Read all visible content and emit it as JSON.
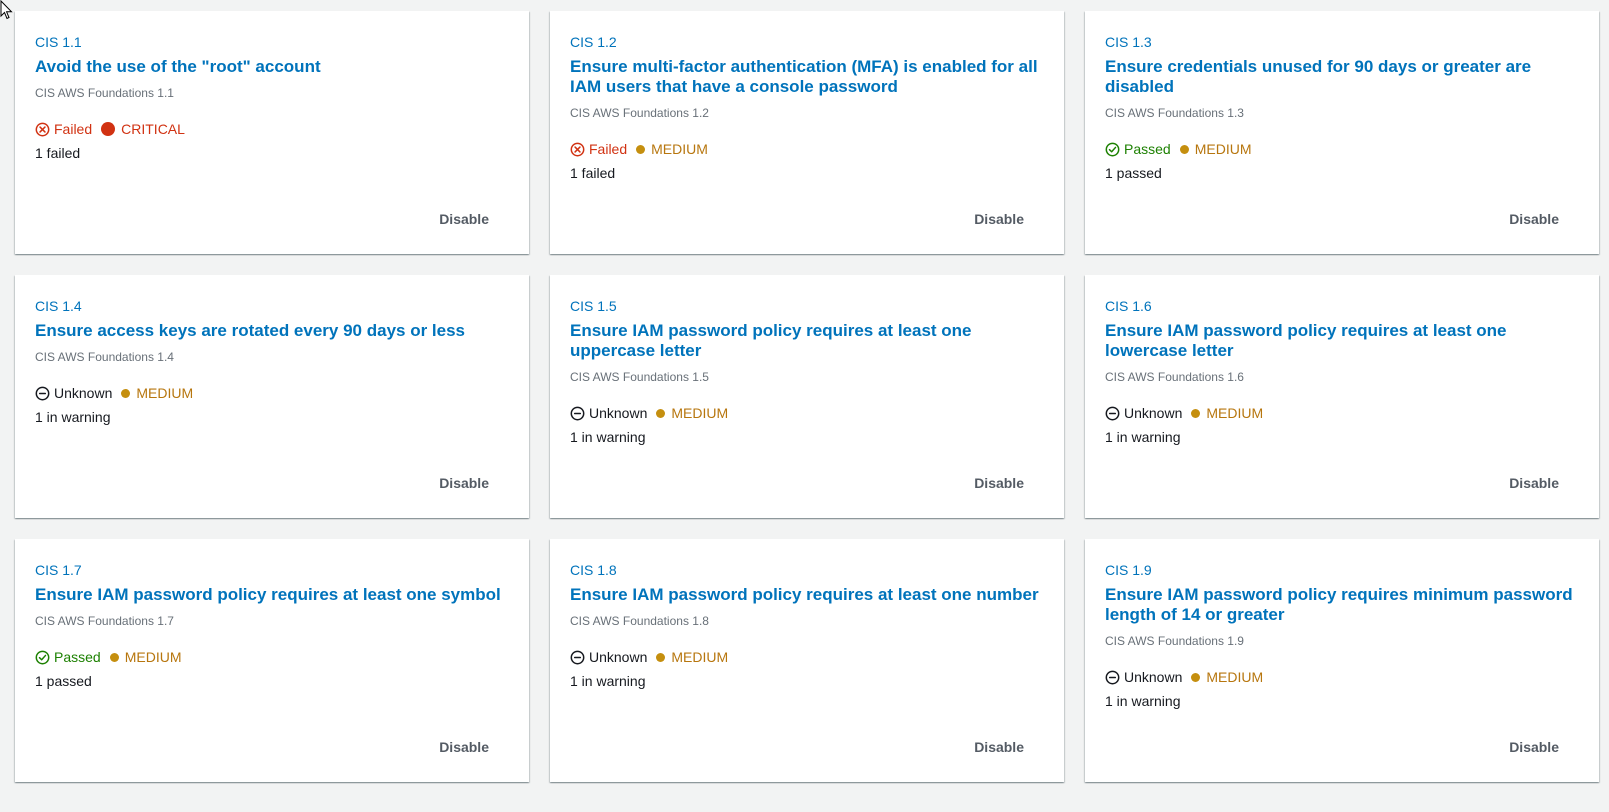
{
  "colors": {
    "link": "#0073bb",
    "failed": "#d13212",
    "passed": "#1d8102",
    "critical": "#d13212",
    "medium": "#c58f0f",
    "medium_text": "#b7760e"
  },
  "cards": [
    {
      "id": "CIS 1.1",
      "title": "Avoid the use of the \"root\" account",
      "subtitle": "CIS AWS Foundations 1.1",
      "status": "Failed",
      "status_icon": "x-circle-icon",
      "severity": "CRITICAL",
      "count": "1 failed",
      "action": "Disable"
    },
    {
      "id": "CIS 1.2",
      "title": "Ensure multi-factor authentication (MFA) is enabled for all IAM users that have a console password",
      "subtitle": "CIS AWS Foundations 1.2",
      "status": "Failed",
      "status_icon": "x-circle-icon",
      "severity": "MEDIUM",
      "count": "1 failed",
      "action": "Disable"
    },
    {
      "id": "CIS 1.3",
      "title": "Ensure credentials unused for 90 days or greater are disabled",
      "subtitle": "CIS AWS Foundations 1.3",
      "status": "Passed",
      "status_icon": "check-circle-icon",
      "severity": "MEDIUM",
      "count": "1 passed",
      "action": "Disable"
    },
    {
      "id": "CIS 1.4",
      "title": "Ensure access keys are rotated every 90 days or less",
      "subtitle": "CIS AWS Foundations 1.4",
      "status": "Unknown",
      "status_icon": "minus-circle-icon",
      "severity": "MEDIUM",
      "count": "1 in warning",
      "action": "Disable"
    },
    {
      "id": "CIS 1.5",
      "title": "Ensure IAM password policy requires at least one uppercase letter",
      "subtitle": "CIS AWS Foundations 1.5",
      "status": "Unknown",
      "status_icon": "minus-circle-icon",
      "severity": "MEDIUM",
      "count": "1 in warning",
      "action": "Disable"
    },
    {
      "id": "CIS 1.6",
      "title": "Ensure IAM password policy requires at least one lowercase letter",
      "subtitle": "CIS AWS Foundations 1.6",
      "status": "Unknown",
      "status_icon": "minus-circle-icon",
      "severity": "MEDIUM",
      "count": "1 in warning",
      "action": "Disable"
    },
    {
      "id": "CIS 1.7",
      "title": "Ensure IAM password policy requires at least one symbol",
      "subtitle": "CIS AWS Foundations 1.7",
      "status": "Passed",
      "status_icon": "check-circle-icon",
      "severity": "MEDIUM",
      "count": "1 passed",
      "action": "Disable"
    },
    {
      "id": "CIS 1.8",
      "title": "Ensure IAM password policy requires at least one number",
      "subtitle": "CIS AWS Foundations 1.8",
      "status": "Unknown",
      "status_icon": "minus-circle-icon",
      "severity": "MEDIUM",
      "count": "1 in warning",
      "action": "Disable"
    },
    {
      "id": "CIS 1.9",
      "title": "Ensure IAM password policy requires minimum password length of 14 or greater",
      "subtitle": "CIS AWS Foundations 1.9",
      "status": "Unknown",
      "status_icon": "minus-circle-icon",
      "severity": "MEDIUM",
      "count": "1 in warning",
      "action": "Disable"
    }
  ]
}
